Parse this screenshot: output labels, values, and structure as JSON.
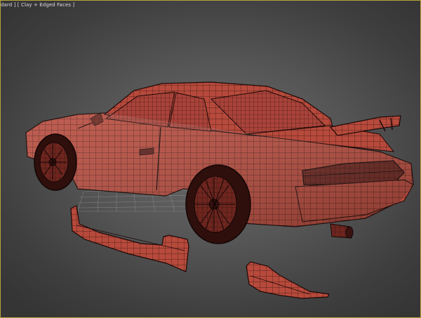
{
  "viewport": {
    "label": "dard ] [ Clay + Edged Faces ]",
    "colors": {
      "border": "#b5a339",
      "clay": "#b74a3c",
      "clay_dark": "#7a2a22",
      "wire": "#2a0f0b",
      "background": "#5a5a5a"
    }
  },
  "scene": {
    "object": "car-model",
    "parts": [
      "car-body",
      "side-skirt",
      "rear-bumper-piece",
      "ground-grid"
    ]
  }
}
